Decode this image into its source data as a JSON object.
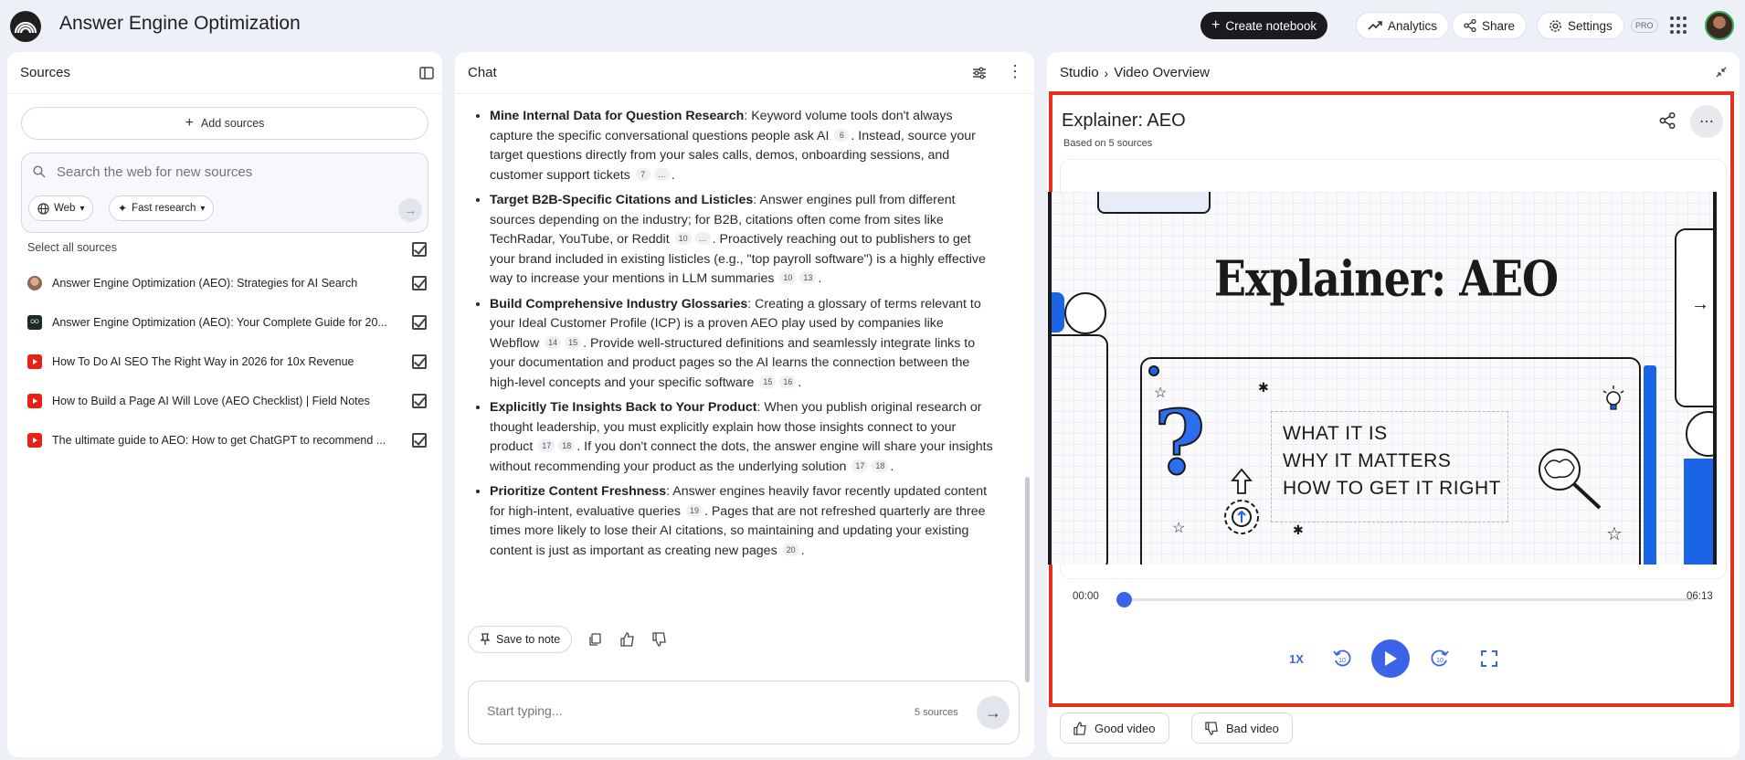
{
  "app": {
    "title": "Answer Engine Optimization"
  },
  "topbar": {
    "create_notebook": "Create notebook",
    "analytics": "Analytics",
    "share": "Share",
    "settings": "Settings",
    "badge": "PRO"
  },
  "sources": {
    "title": "Sources",
    "add_sources": "Add sources",
    "search_placeholder": "Search the web for new sources",
    "web_chip": "Web",
    "research_chip": "Fast research",
    "select_all": "Select all sources",
    "items": [
      {
        "label": "Answer Engine Optimization (AEO): Strategies for AI Search",
        "icon": "person-avatar-icon",
        "checked": true
      },
      {
        "label": "Answer Engine Optimization (AEO): Your Complete Guide for 20...",
        "icon": "website-logo-icon",
        "checked": true
      },
      {
        "label": "How To Do AI SEO The Right Way in 2026 for 10x Revenue",
        "icon": "youtube-icon",
        "checked": true
      },
      {
        "label": "How to Build a Page AI Will Love (AEO Checklist) | Field Notes",
        "icon": "youtube-icon",
        "checked": true
      },
      {
        "label": "The ultimate guide to AEO: How to get ChatGPT to recommend ...",
        "icon": "youtube-icon",
        "checked": true
      }
    ]
  },
  "chat": {
    "title": "Chat",
    "items": [
      {
        "heading": "Mine Internal Data for Question Research",
        "parts": [
          ": Keyword volume tools don't always capture the specific conversational questions people ask AI ",
          "[6]",
          ". Instead, source your target questions directly from your sales calls, demos, onboarding sessions, and customer support tickets ",
          "[7]",
          "[…]",
          "."
        ]
      },
      {
        "heading": "Target B2B-Specific Citations and Listicles",
        "parts": [
          ": Answer engines pull from different sources depending on the industry; for B2B, citations often come from sites like TechRadar, YouTube, or Reddit ",
          "[10]",
          "[…]",
          ". Proactively reaching out to publishers to get your brand included in existing listicles (e.g., \"top payroll software\") is a highly effective way to increase your mentions in LLM summaries ",
          "[10]",
          "[13]",
          "."
        ]
      },
      {
        "heading": "Build Comprehensive Industry Glossaries",
        "parts": [
          ": Creating a glossary of terms relevant to your Ideal Customer Profile (ICP) is a proven AEO play used by companies like Webflow ",
          "[14]",
          "[15]",
          ". Provide well-structured definitions and seamlessly integrate links to your documentation and product pages so the AI learns the connection between the high-level concepts and your specific software ",
          "[15]",
          "[16]",
          "."
        ]
      },
      {
        "heading": "Explicitly Tie Insights Back to Your Product",
        "parts": [
          ": When you publish original research or thought leadership, you must explicitly explain how those insights connect to your product ",
          "[17]",
          "[18]",
          ". If you don't connect the dots, the answer engine will share your insights without recommending your product as the underlying solution ",
          "[17]",
          "[18]",
          "."
        ]
      },
      {
        "heading": "Prioritize Content Freshness",
        "parts": [
          ": Answer engines heavily favor recently updated content for high-intent, evaluative queries ",
          "[19]",
          ". Pages that are not refreshed quarterly are three times more likely to lose their AI citations, so maintaining and updating your existing content is just as important as creating new pages ",
          "[20]",
          "."
        ]
      }
    ],
    "save_to_note": "Save to note",
    "composer_placeholder": "Start typing...",
    "source_count": "5 sources"
  },
  "studio": {
    "crumb_root": "Studio",
    "crumb_current": "Video Overview",
    "video_title": "Explainer: AEO",
    "video_subtitle": "Based on 5 sources",
    "frame_title": "Explainer: AEO",
    "frame_lines": [
      "WHAT IT IS",
      "WHY IT MATTERS",
      "HOW TO GET IT RIGHT"
    ],
    "time_current": "00:00",
    "time_total": "06:13",
    "progress": 0.0,
    "speed": "1X",
    "rewind_label": "10",
    "forward_label": "10",
    "good_video": "Good video",
    "bad_video": "Bad video",
    "accent_color": "#3b63e8",
    "highlight_color": "#e8301c"
  }
}
